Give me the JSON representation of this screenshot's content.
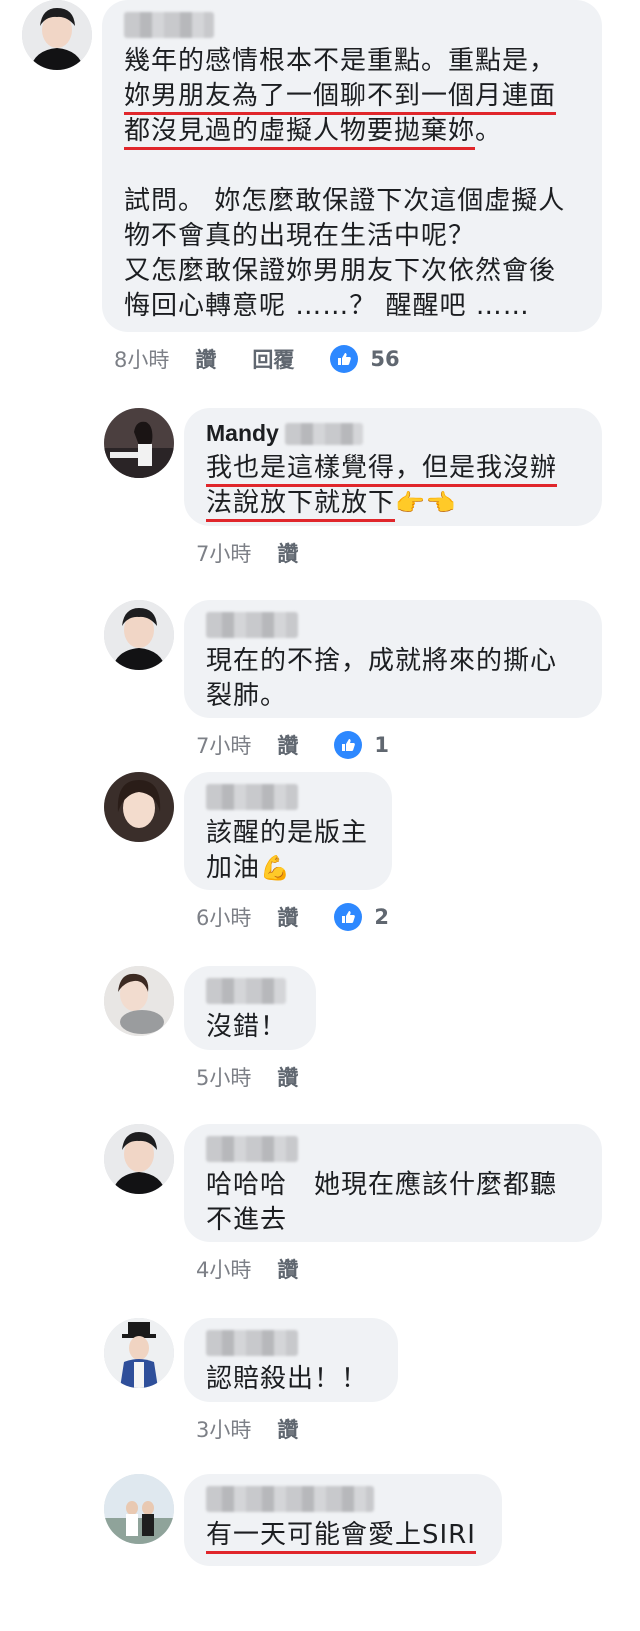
{
  "comments": [
    {
      "author_blurred": true,
      "lines": [
        "幾年的感情根本不是重點。重點是，"
      ],
      "ul_lines": [
        "妳男朋友為了一個聊不到一個月連面",
        "都沒見過的虛擬人物要拋棄妳"
      ],
      "after_ul": "。",
      "body_rest": "試問。 妳怎麼敢保證下次這個虛擬人\n物不會真的出現在生活中呢？\n又怎麼敢保證妳男朋友下次依然會後\n悔回心轉意呢 ……？ 醒醒吧 ……",
      "time": "8小時",
      "like_label": "讚",
      "reply_label": "回覆",
      "likes": "56"
    },
    {
      "author": "Mandy",
      "ul_lines": [
        "我也是這樣覺得，但是我沒辦",
        "法說放下就放下"
      ],
      "emoji": "👉👈",
      "time": "7小時",
      "like_label": "讚"
    },
    {
      "text": "現在的不捨，成就將來的撕心\n裂肺。",
      "time": "7小時",
      "like_label": "讚",
      "likes": "1"
    },
    {
      "text": "該醒的是版主\n加油",
      "emoji": "💪",
      "time": "6小時",
      "like_label": "讚",
      "likes": "2"
    },
    {
      "text": "沒錯！",
      "time": "5小時",
      "like_label": "讚"
    },
    {
      "text": "哈哈哈　她現在應該什麼都聽\n不進去",
      "time": "4小時",
      "like_label": "讚"
    },
    {
      "text": "認賠殺出！！",
      "time": "3小時",
      "like_label": "讚"
    },
    {
      "ul_text": "有一天可能會愛上SIRI"
    }
  ],
  "colors": {
    "bubble": "#f0f2f5",
    "underline": "#e0262b",
    "like_blue": "#2d88ff"
  }
}
